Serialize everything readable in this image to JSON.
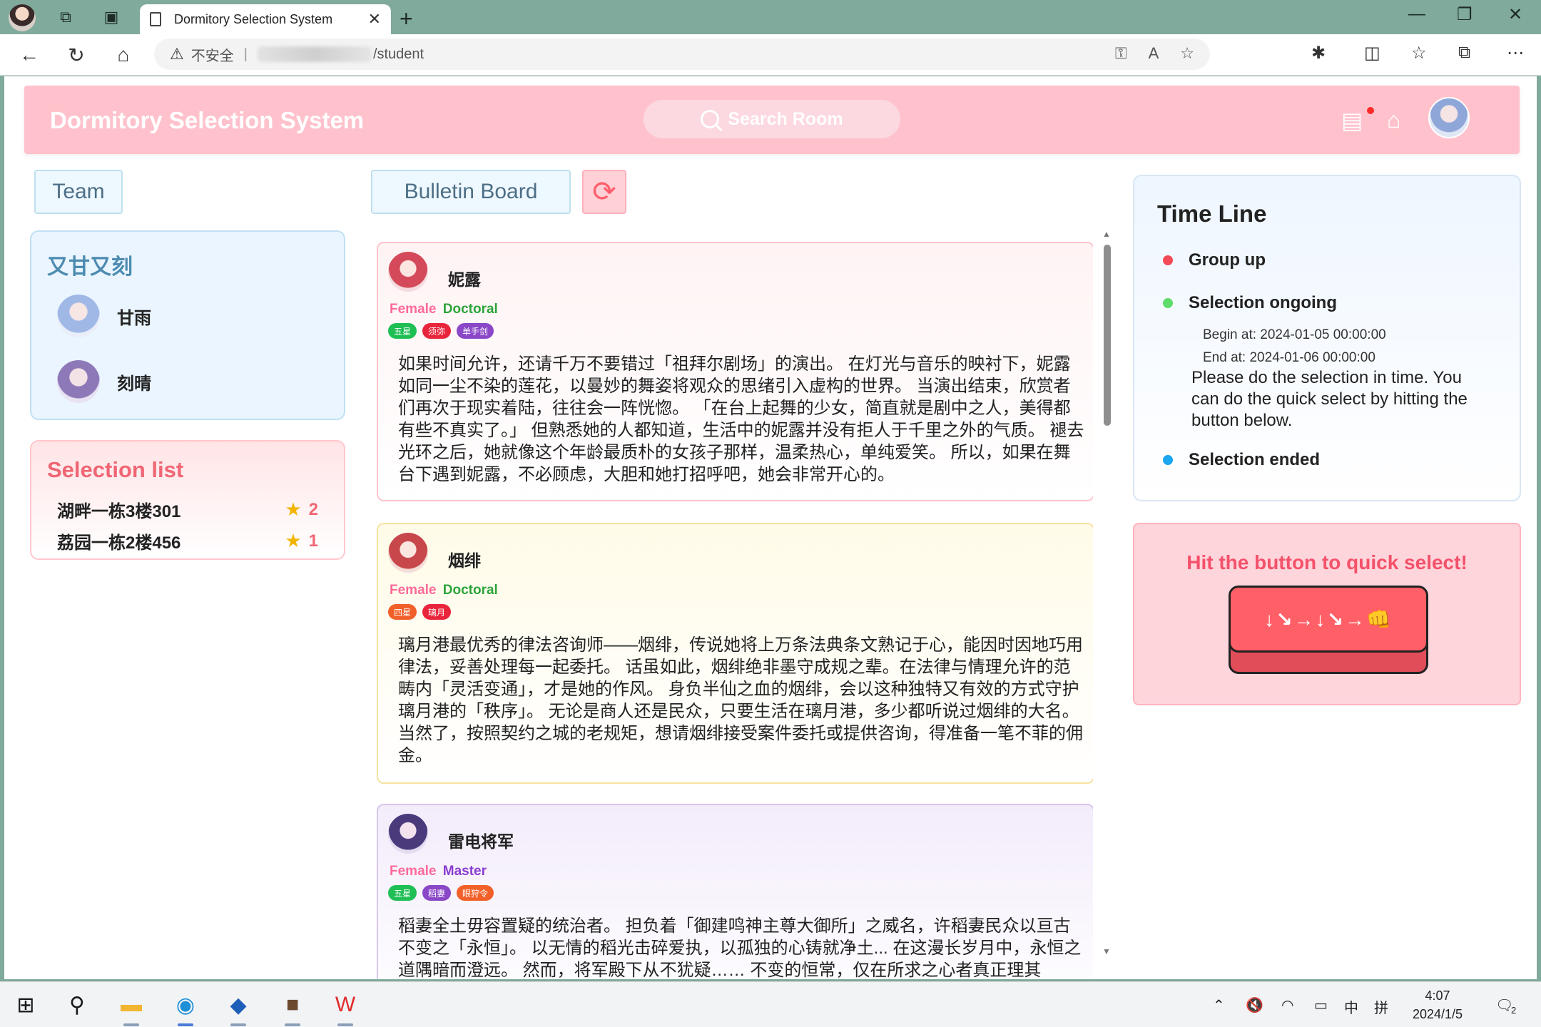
{
  "browser": {
    "tab_title": "Dormitory Selection System",
    "insecure_label": "不安全",
    "separator": "|",
    "url_path": "/student"
  },
  "header": {
    "brand": "Dormitory Selection System",
    "search_placeholder": "Search Room"
  },
  "team_button": "Team",
  "bulletin_button": "Bulletin Board",
  "team": {
    "name": "又甘又刻",
    "members": [
      {
        "name": "甘雨"
      },
      {
        "name": "刻晴"
      }
    ]
  },
  "selection_list": {
    "title": "Selection list",
    "items": [
      {
        "room": "湖畔一栋3楼301",
        "count": "2"
      },
      {
        "room": "荔园一栋2楼456",
        "count": "1"
      }
    ]
  },
  "posts": [
    {
      "name": "妮露",
      "gender": "Female",
      "degree": "Doctoral",
      "tags": [
        {
          "label": "五星",
          "color": "#1fbf55"
        },
        {
          "label": "须弥",
          "color": "#e8253b"
        },
        {
          "label": "单手剑",
          "color": "#8a47c7"
        }
      ],
      "desc": "如果时间允许，还请千万不要错过「祖拜尔剧场」的演出。 在灯光与音乐的映衬下，妮露如同一尘不染的莲花，以曼妙的舞姿将观众的思绪引入虚构的世界。 当演出结束，欣赏者们再次于现实着陆，往往会一阵恍惚。 「在台上起舞的少女，简直就是剧中之人，美得都有些不真实了。」 但熟悉她的人都知道，生活中的妮露并没有拒人于千里之外的气质。 褪去光环之后，她就像这个年龄最质朴的女孩子那样，温柔热心，单纯爱笑。 所以，如果在舞台下遇到妮露，不必顾虑，大胆和她打招呼吧，她会非常开心的。"
    },
    {
      "name": "烟绯",
      "gender": "Female",
      "degree": "Doctoral",
      "tags": [
        {
          "label": "四星",
          "color": "#f2602a"
        },
        {
          "label": "璃月",
          "color": "#e8253b"
        }
      ],
      "desc": "璃月港最优秀的律法咨询师——烟绯，传说她将上万条法典条文熟记于心，能因时因地巧用律法，妥善处理每一起委托。 话虽如此，烟绯绝非墨守成规之辈。在法律与情理允许的范畴内「灵活变通」，才是她的作风。 身负半仙之血的烟绯，会以这种独特又有效的方式守护璃月港的「秩序」。 无论是商人还是民众，只要生活在璃月港，多少都听说过烟绯的大名。当然了，按照契约之城的老规矩，想请烟绯接受案件委托或提供咨询，得准备一笔不菲的佣金。"
    },
    {
      "name": "雷电将军",
      "gender": "Female",
      "degree": "Master",
      "tags": [
        {
          "label": "五星",
          "color": "#1fbf55"
        },
        {
          "label": "稻妻",
          "color": "#8a47c7"
        },
        {
          "label": "眼狩令",
          "color": "#f2602a"
        }
      ],
      "desc": "稻妻全土毋容置疑的统治者。 担负着「御建鸣神主尊大御所」之威名，许稻妻民众以亘古不变之「永恒」。 以无情的稻光击碎爱执，以孤独的心铸就净土... 在这漫长岁月中，永恒之道隅暗而澄远。 然而，将军殿下从不犹疑…… 不变的恒常，仅在所求之心者真正理其"
    }
  ],
  "timeline": {
    "title": "Time Line",
    "items": [
      {
        "label": "Group up",
        "color": "#f24a57"
      },
      {
        "label": "Selection ongoing",
        "color": "#5fdc6a"
      },
      {
        "label": "Selection ended",
        "color": "#1aa6f0"
      }
    ],
    "begin": "Begin at: 2024-01-05 00:00:00",
    "end": "End at: 2024-01-06 00:00:00",
    "note": "Please do the selection in time. You can do the quick select by hitting the button below."
  },
  "quick_select": {
    "title": "Hit the button to quick select!",
    "button": "↓↘→↓↘→👊"
  },
  "taskbar": {
    "lang": "中",
    "ime": "拼",
    "time": "4:07",
    "date": "2024/1/5",
    "notif_count": "2"
  }
}
